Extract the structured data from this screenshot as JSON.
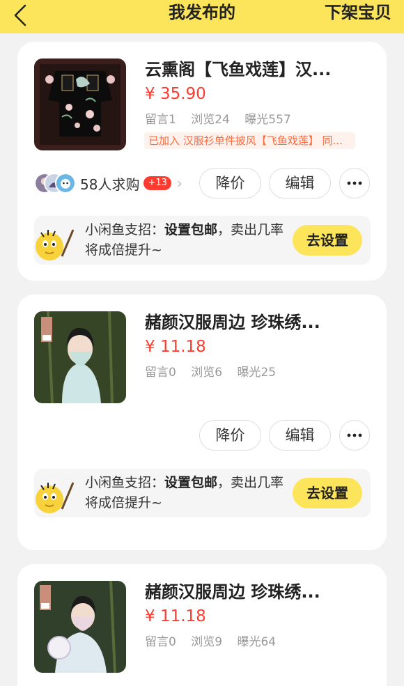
{
  "header": {
    "title": "我发布的",
    "action": "下架宝贝"
  },
  "colors": {
    "accent": "#fde55b",
    "price": "#ff3b30",
    "tag_text": "#ff6a3d",
    "tag_bg": "#fff1ec"
  },
  "items": [
    {
      "title": "云熏阁【飞鱼戏莲】汉...",
      "price": "¥ 35.90",
      "stats": {
        "comments": "留言1",
        "views": "浏览24",
        "exposure": "曝光557"
      },
      "tag": "已加入 汉服衫单件披风【飞鱼戏莲】 同...",
      "demand": {
        "text": "58人求购",
        "badge": "+13"
      },
      "buttons": {
        "reduce": "降价",
        "edit": "编辑"
      },
      "tip": {
        "prefix": "小闲鱼支招：",
        "bold": "设置包邮",
        "suffix": "，卖出几率将成倍提升~",
        "button": "去设置"
      }
    },
    {
      "title": "赭颜汉服周边 珍珠绣...",
      "price": "¥ 11.18",
      "stats": {
        "comments": "留言0",
        "views": "浏览6",
        "exposure": "曝光25"
      },
      "buttons": {
        "reduce": "降价",
        "edit": "编辑"
      },
      "tip": {
        "prefix": "小闲鱼支招：",
        "bold": "设置包邮",
        "suffix": "，卖出几率将成倍提升~",
        "button": "去设置"
      }
    },
    {
      "title": "赭颜汉服周边 珍珠绣...",
      "price": "¥ 11.18",
      "stats": {
        "comments": "留言0",
        "views": "浏览9",
        "exposure": "曝光64"
      }
    }
  ]
}
